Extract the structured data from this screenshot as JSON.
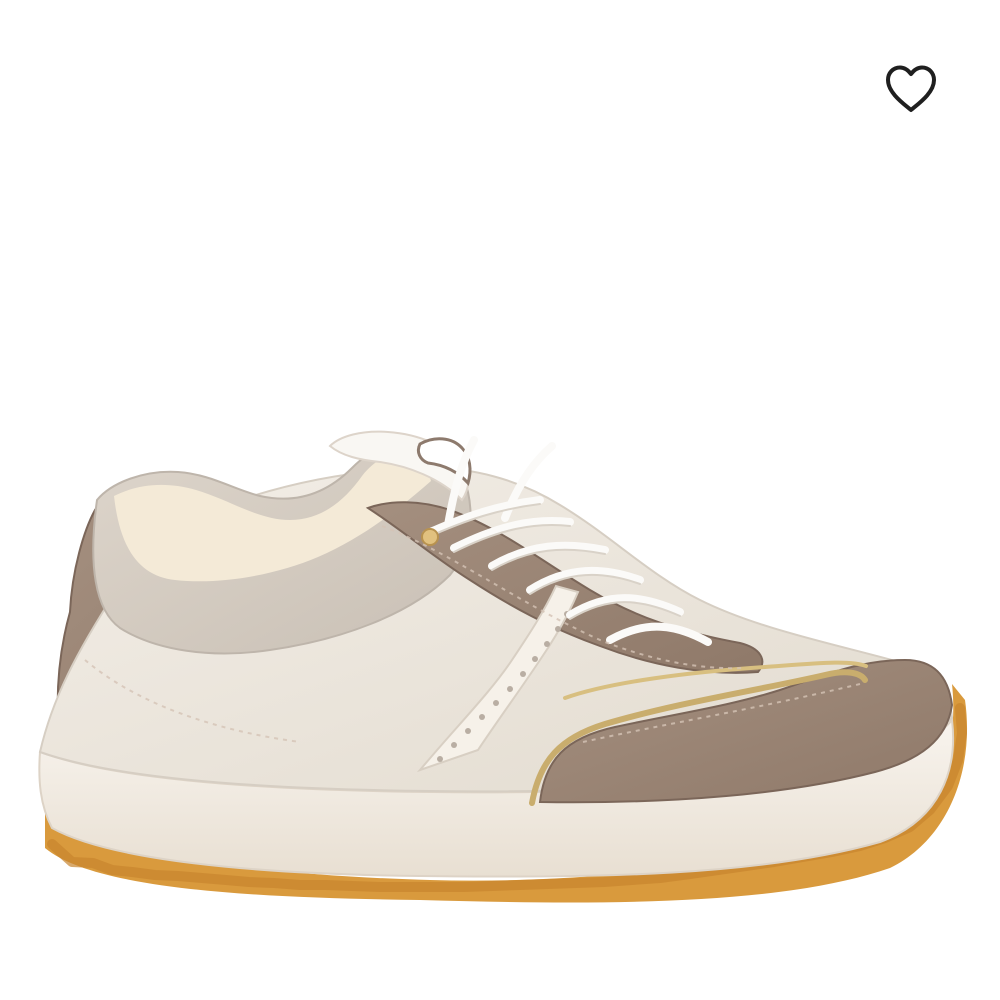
{
  "product": {
    "image_alt": "Sneaker",
    "colors": {
      "sole": "#f4eee4",
      "gum": "#d99a3d",
      "suede": "#a08b7a",
      "upper": "#ece6dc",
      "felt": "#d7cfc5",
      "gold": "#c9ad6d"
    }
  },
  "wishlist": {
    "icon": "heart-icon",
    "state": "not-saved",
    "color": "#1f1f1f"
  }
}
